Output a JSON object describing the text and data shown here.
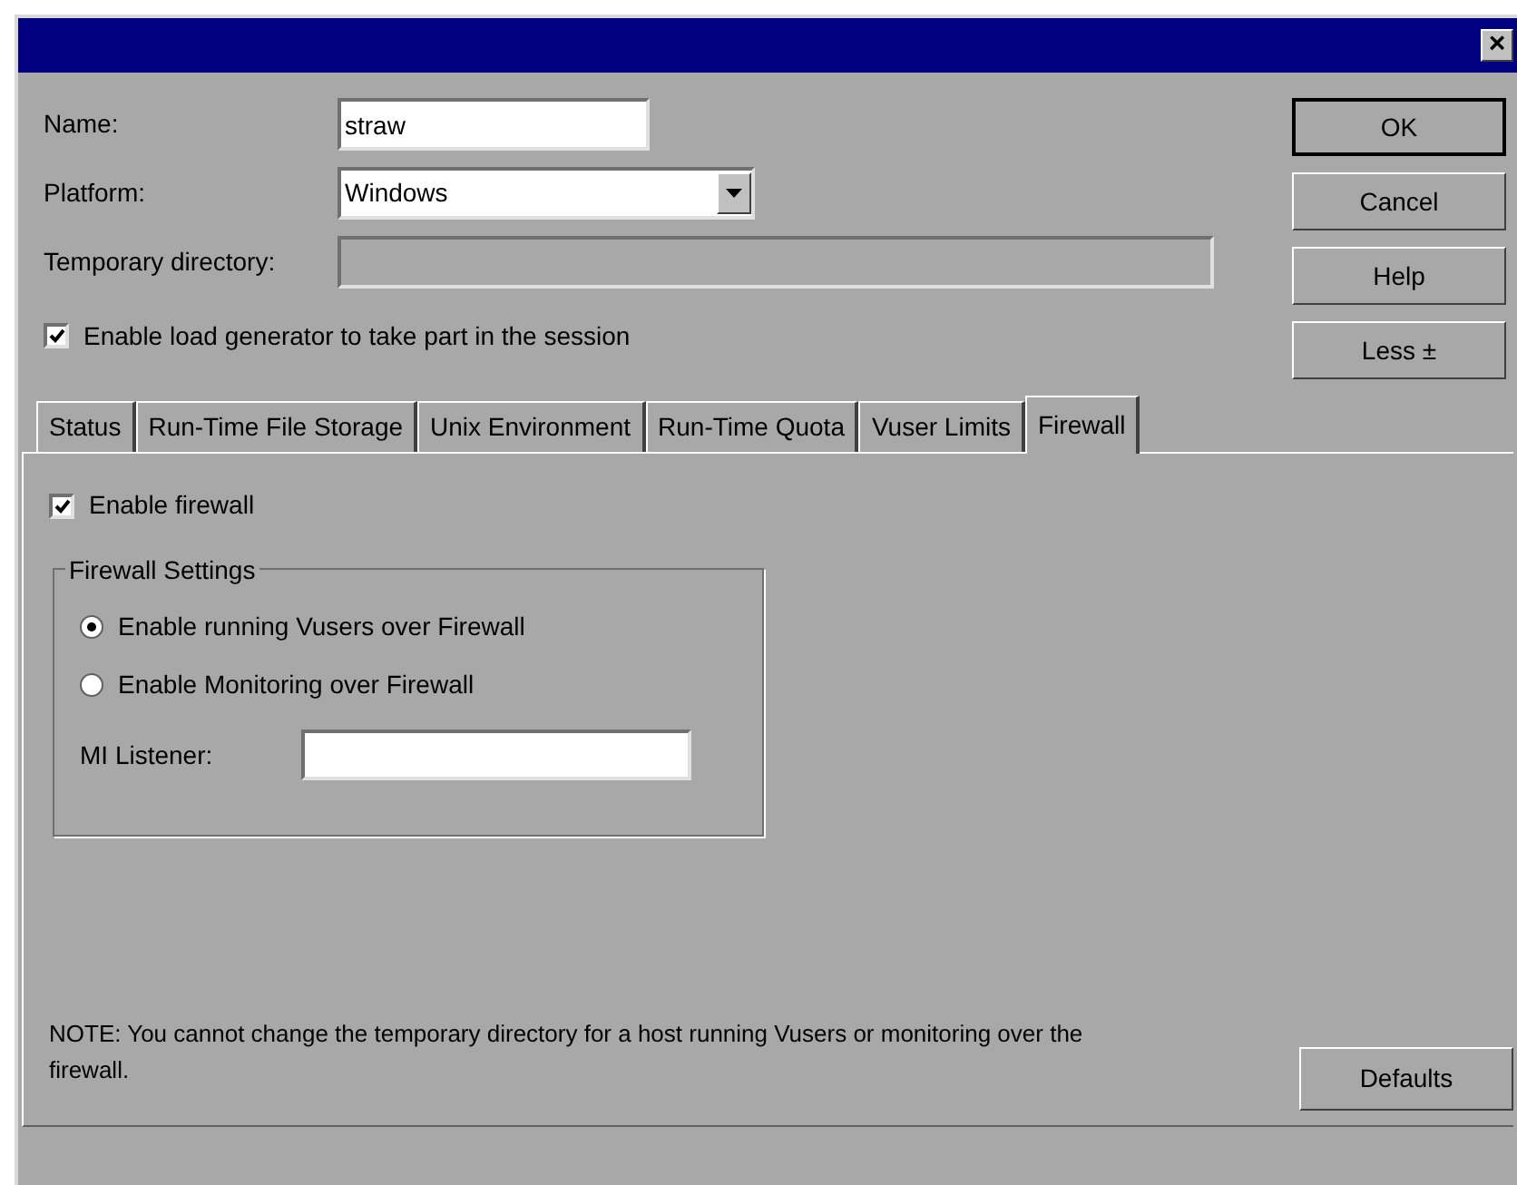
{
  "window": {
    "close": "×"
  },
  "fields": {
    "name": {
      "label": "Name:",
      "value": "straw"
    },
    "platform": {
      "label": "Platform:",
      "value": "Windows"
    },
    "temp_dir": {
      "label": "Temporary directory:",
      "disabled": true
    }
  },
  "enable_load_generator": {
    "label": "Enable load generator to take part in the session",
    "checked": true
  },
  "buttons": [
    {
      "label": "OK",
      "default": true
    },
    {
      "label": "Cancel",
      "default": false
    },
    {
      "label": "Help",
      "default": false
    },
    {
      "label": "Less ±",
      "default": false
    }
  ],
  "tabs": [
    {
      "label": "Status",
      "selected": false
    },
    {
      "label": "Run-Time File Storage",
      "selected": false
    },
    {
      "label": "Unix Environment",
      "selected": false
    },
    {
      "label": "Run-Time Quota",
      "selected": false
    },
    {
      "label": "Vuser Limits",
      "selected": false
    },
    {
      "label": "Firewall",
      "selected": true
    }
  ],
  "enable_firewall": {
    "label": "Enable firewall",
    "checked": true
  },
  "firewall_settings": {
    "title": "Firewall Settings",
    "options": [
      {
        "label": "Enable running Vusers over Firewall",
        "selected": true
      },
      {
        "label": "Enable Monitoring over Firewall",
        "selected": false
      }
    ],
    "mi_listener": {
      "label": "MI Listener:"
    }
  },
  "note": "NOTE: You cannot change the temporary directory for a host running Vusers or monitoring over the firewall.",
  "defaults_button": "Defaults"
}
